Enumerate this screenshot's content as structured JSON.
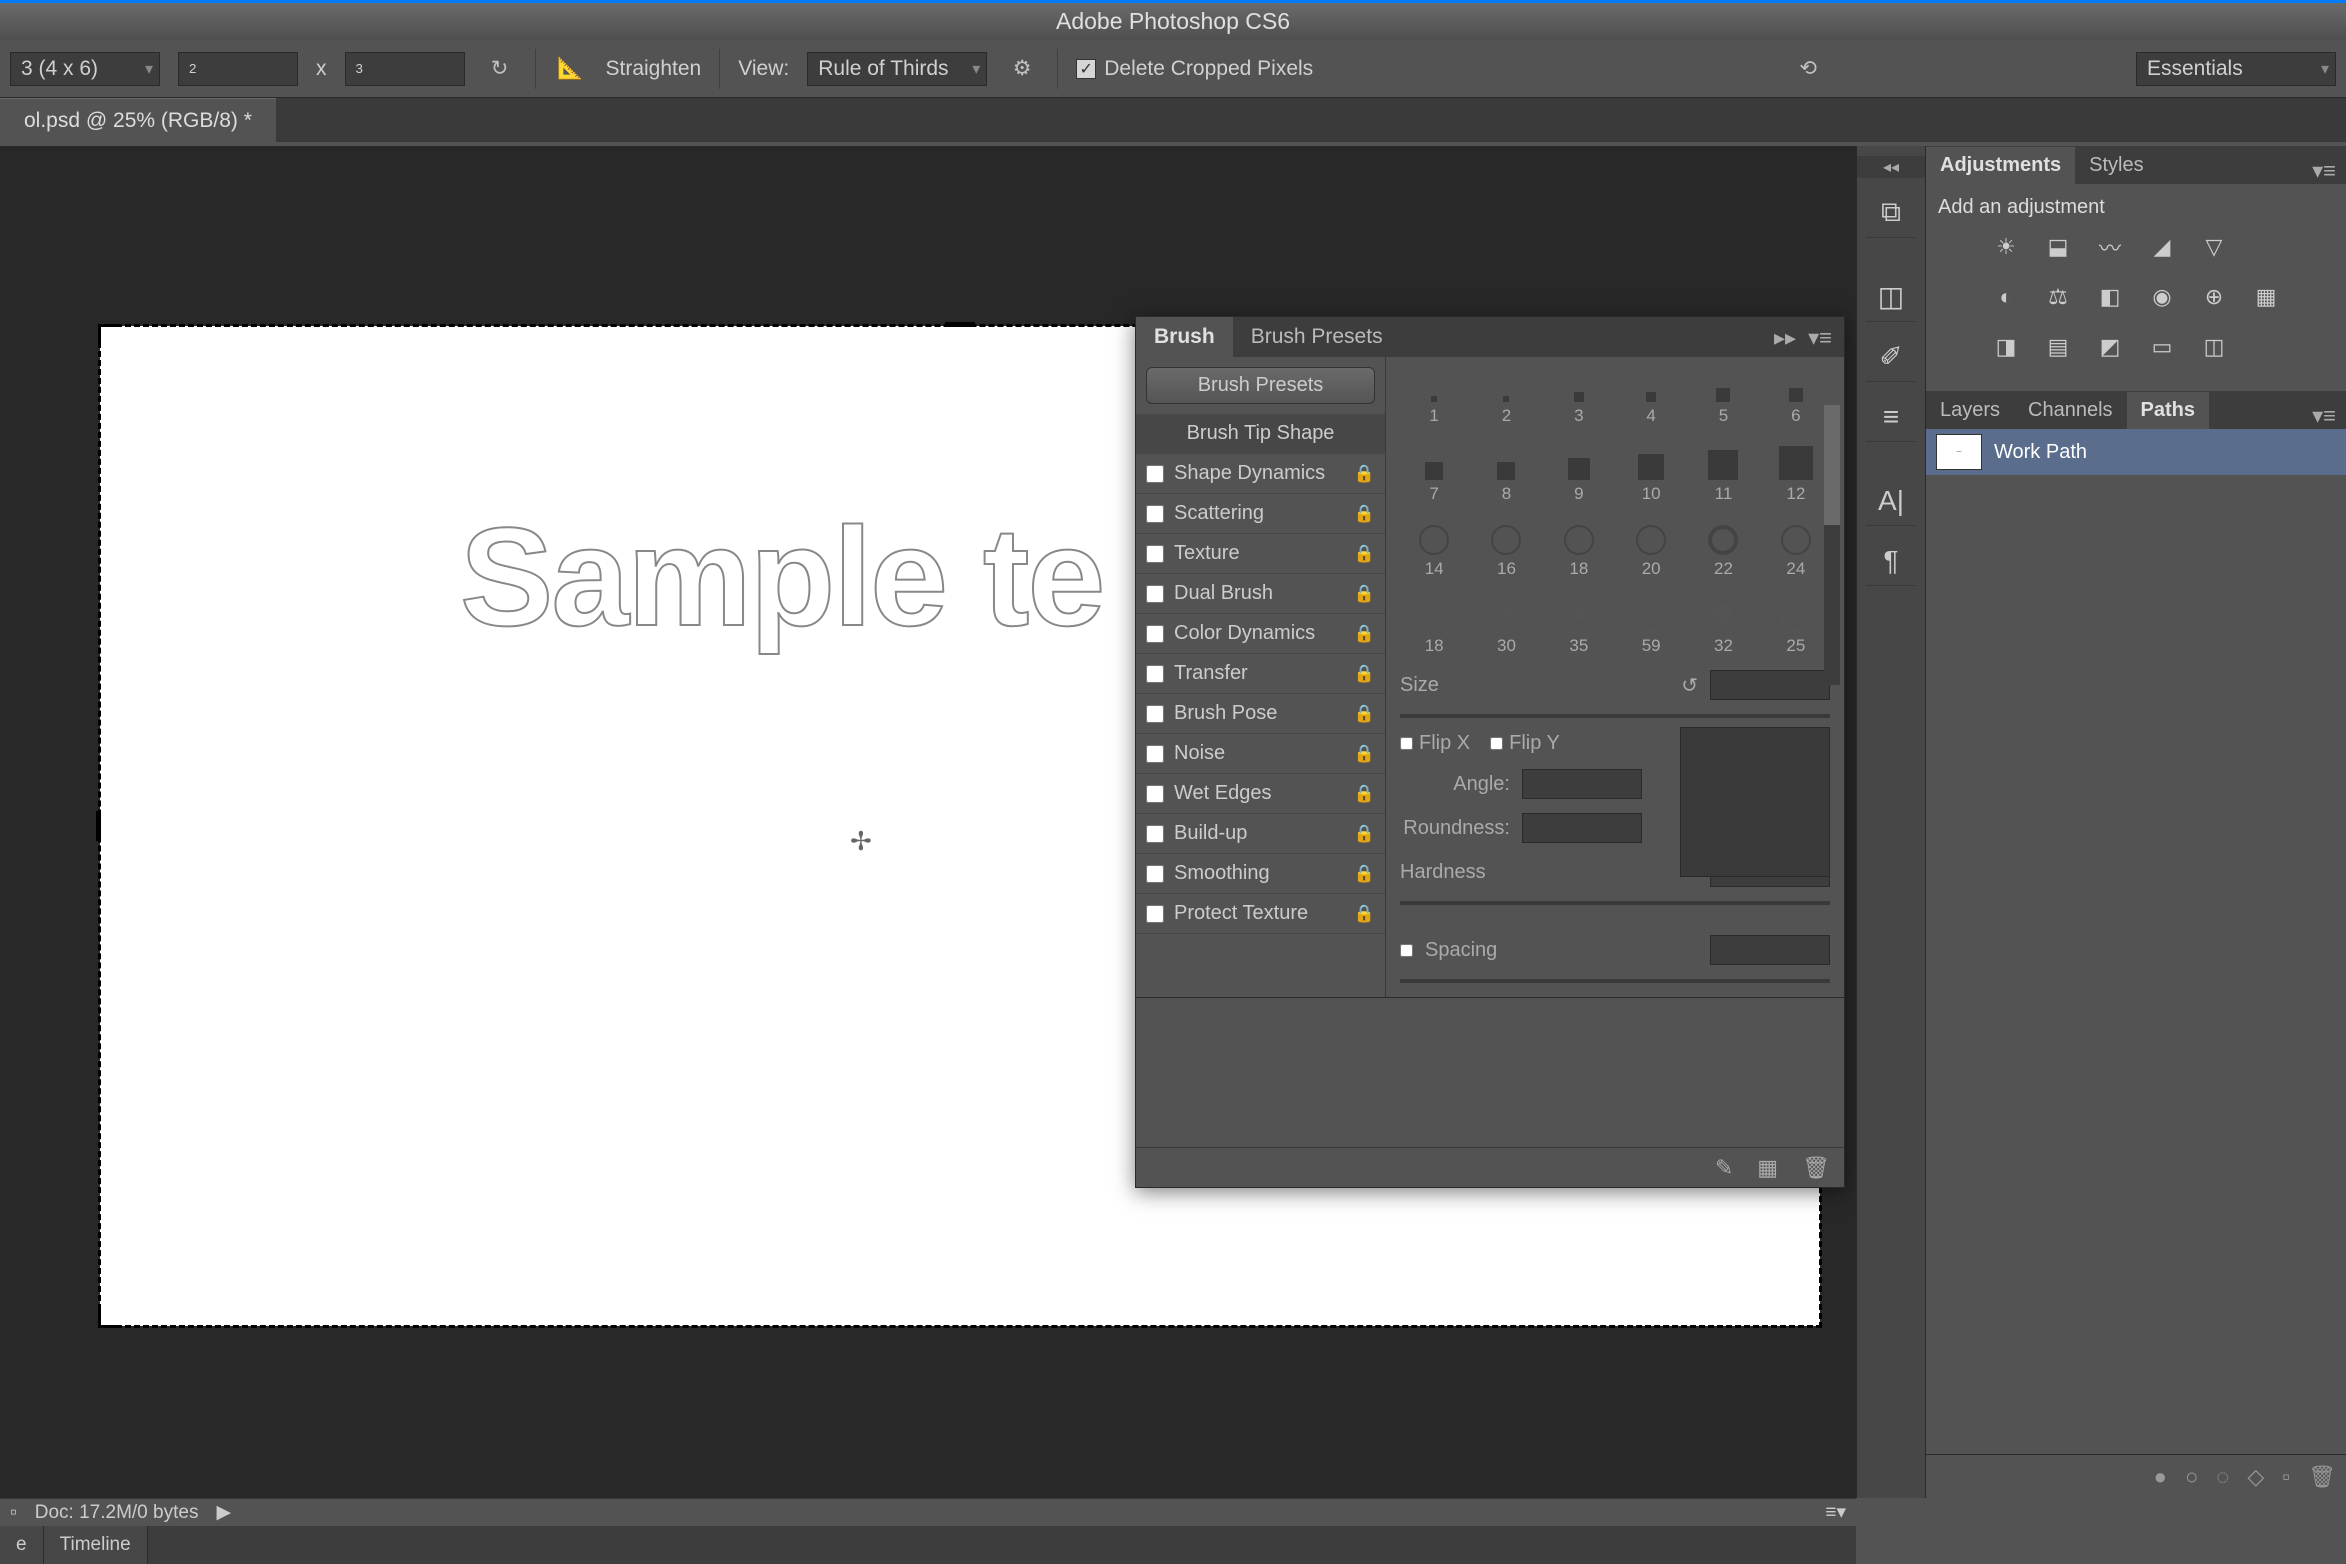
{
  "app": {
    "title": "Adobe Photoshop CS6"
  },
  "options": {
    "ratio_preset": "3 (4 x 6)",
    "width": "2",
    "sep": "x",
    "height": "3",
    "straighten": "Straighten",
    "view_label": "View:",
    "view_value": "Rule of Thirds",
    "delete_cropped": "Delete Cropped Pixels",
    "workspace": "Essentials"
  },
  "document": {
    "tab": "ol.psd @ 25% (RGB/8) *"
  },
  "canvas": {
    "sample_text": "Sample te"
  },
  "brush_panel": {
    "tabs": {
      "brush": "Brush",
      "presets": "Brush Presets"
    },
    "presets_button": "Brush Presets",
    "tip_shape": "Brush Tip Shape",
    "options": [
      "Shape Dynamics",
      "Scattering",
      "Texture",
      "Dual Brush",
      "Color Dynamics",
      "Transfer",
      "Brush Pose",
      "Noise",
      "Wet Edges",
      "Build-up",
      "Smoothing",
      "Protect Texture"
    ],
    "sizes_row1": [
      "1",
      "2",
      "3",
      "4",
      "5",
      "6"
    ],
    "sizes_row2": [
      "7",
      "8",
      "9",
      "10",
      "11",
      "12"
    ],
    "sizes_row3": [
      "14",
      "16",
      "18",
      "20",
      "22",
      "24"
    ],
    "sizes_row4": [
      "18",
      "30",
      "35",
      "59",
      "32",
      "25"
    ],
    "size_label": "Size",
    "flip_x": "Flip X",
    "flip_y": "Flip Y",
    "angle": "Angle:",
    "roundness": "Roundness:",
    "hardness": "Hardness",
    "spacing": "Spacing"
  },
  "adjustments": {
    "tab_adj": "Adjustments",
    "tab_styles": "Styles",
    "add_label": "Add an adjustment"
  },
  "paths": {
    "tab_layers": "Layers",
    "tab_channels": "Channels",
    "tab_paths": "Paths",
    "item": "Work Path"
  },
  "status": {
    "doc_size": "Doc: 17.2M/0 bytes"
  },
  "bottom_tabs": {
    "mini": "e",
    "timeline": "Timeline"
  }
}
